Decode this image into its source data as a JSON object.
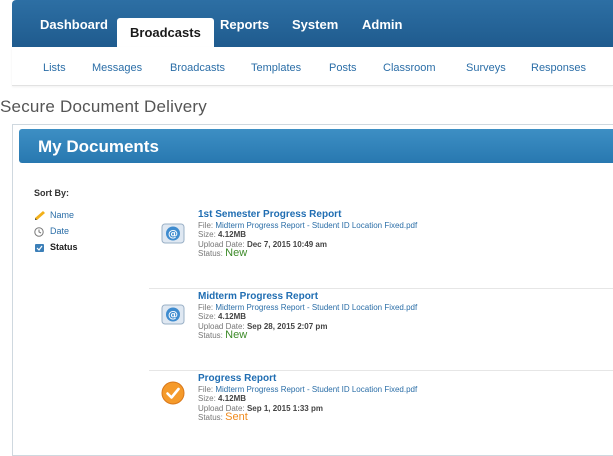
{
  "top_nav": {
    "tabs": [
      {
        "label": "Dashboard"
      },
      {
        "label": "Broadcasts",
        "active": true
      },
      {
        "label": "Reports"
      },
      {
        "label": "System"
      },
      {
        "label": "Admin"
      }
    ]
  },
  "sub_nav": {
    "items": [
      "Lists",
      "Messages",
      "Broadcasts",
      "Templates",
      "Posts",
      "Classroom",
      "Surveys",
      "Responses"
    ]
  },
  "page": {
    "title": "Secure Document Delivery"
  },
  "panel": {
    "title": "My Documents"
  },
  "sort": {
    "label": "Sort By:",
    "options": [
      {
        "label": "Name",
        "icon": "pencil-icon"
      },
      {
        "label": "Date",
        "icon": "clock-icon"
      },
      {
        "label": "Status",
        "icon": "status-icon",
        "active": true
      }
    ]
  },
  "labels": {
    "file": "File:",
    "size": "Size:",
    "upload_date": "Upload Date:",
    "status": "Status:"
  },
  "documents": [
    {
      "name": "1st Semester Progress Report",
      "file": "Midterm Progress Report - Student ID Location Fixed.pdf",
      "size": "4.12MB",
      "upload_date": "Dec 7, 2015 10:49 am",
      "status": "New",
      "icon": "email-at-icon"
    },
    {
      "name": "Midterm Progress Report",
      "file": "Midterm Progress Report - Student ID Location Fixed.pdf",
      "size": "4.12MB",
      "upload_date": "Sep 28, 2015 2:07 pm",
      "status": "New",
      "icon": "email-at-icon"
    },
    {
      "name": "Progress Report",
      "file": "Midterm Progress Report - Student ID Location Fixed.pdf",
      "size": "4.12MB",
      "upload_date": "Sep 1, 2015 1:33 pm",
      "status": "Sent",
      "icon": "check-circle-icon"
    }
  ],
  "colors": {
    "nav_blue": "#1f5b8e",
    "panel_blue": "#2878b0",
    "link_blue": "#1f6db2",
    "status_new": "#3c8a28",
    "status_sent": "#f08a1c"
  }
}
